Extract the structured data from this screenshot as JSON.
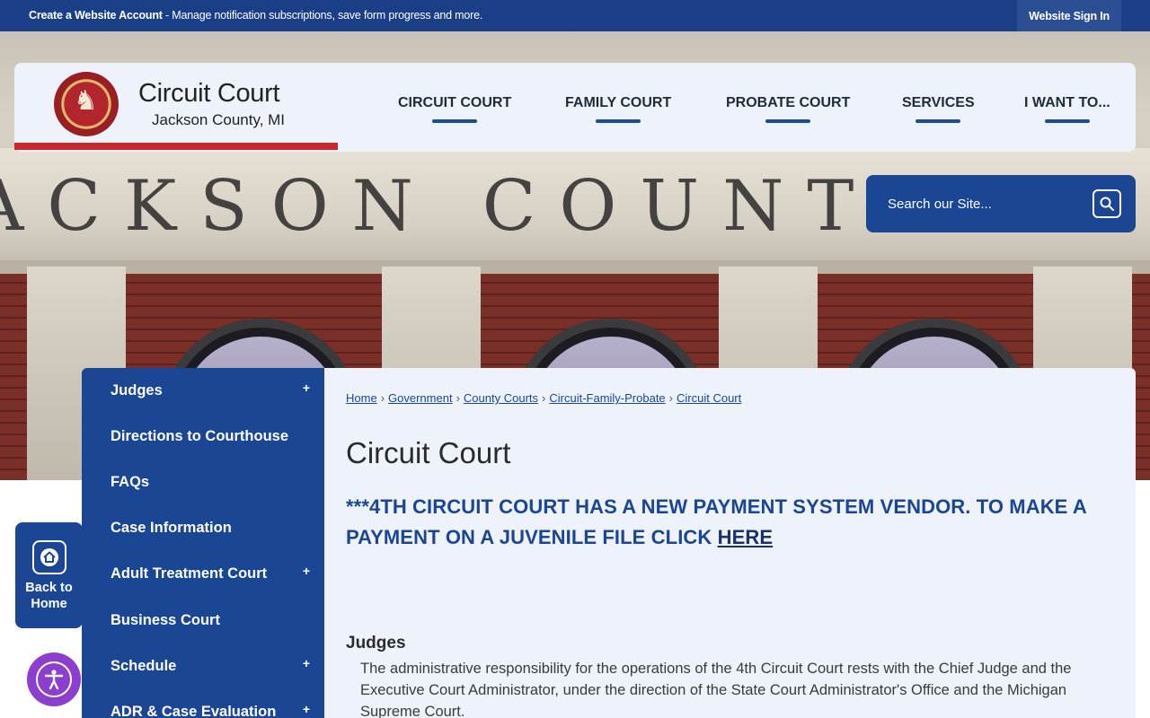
{
  "topbar": {
    "account_link": "Create a Website Account",
    "account_desc": " - Manage notification subscriptions, save form progress and more.",
    "signin": "Website Sign In"
  },
  "hero": {
    "engraving": "ACKSON COUNTY BUILDIN"
  },
  "header": {
    "logo_alt": "County of Jackson seal",
    "title": "Circuit Court",
    "subtitle": "Jackson County, MI"
  },
  "nav": [
    {
      "label": "CIRCUIT COURT"
    },
    {
      "label": "FAMILY COURT"
    },
    {
      "label": "PROBATE COURT"
    },
    {
      "label": "SERVICES"
    },
    {
      "label": "I WANT TO..."
    }
  ],
  "search": {
    "placeholder": "Search our Site..."
  },
  "back_home": {
    "label_line1": "Back to",
    "label_line2": "Home"
  },
  "sidebar": {
    "items": [
      {
        "label": "Judges",
        "expandable": "+"
      },
      {
        "label": "Directions to Courthouse",
        "expandable": ""
      },
      {
        "label": "FAQs",
        "expandable": ""
      },
      {
        "label": "Case Information",
        "expandable": ""
      },
      {
        "label": "Adult Treatment Court",
        "expandable": "+"
      },
      {
        "label": "Business Court",
        "expandable": ""
      },
      {
        "label": "Schedule",
        "expandable": "+"
      },
      {
        "label": "ADR & Case Evaluation",
        "expandable": "+"
      }
    ]
  },
  "breadcrumb": [
    "Home",
    "Government",
    "County Courts",
    "Circuit-Family-Probate",
    "Circuit Court"
  ],
  "main": {
    "title": "Circuit Court",
    "notice_text": "***4TH CIRCUIT COURT HAS A NEW PAYMENT SYSTEM VENDOR.  TO MAKE A PAYMENT ON A JUVENILE FILE CLICK ",
    "notice_link": "HERE",
    "section_heading": "Judges",
    "section_body": "The administrative responsibility for the operations of the 4th Circuit Court rests with the Chief Judge and the Executive Court Administrator, under the direction of the State Court Administrator's Office and the Michigan Supreme Court."
  },
  "colors": {
    "brand_blue": "#1a4694",
    "topbar_blue": "#1a3f86",
    "accent_red": "#c8272d",
    "a11y_purple": "#8c3fce"
  }
}
